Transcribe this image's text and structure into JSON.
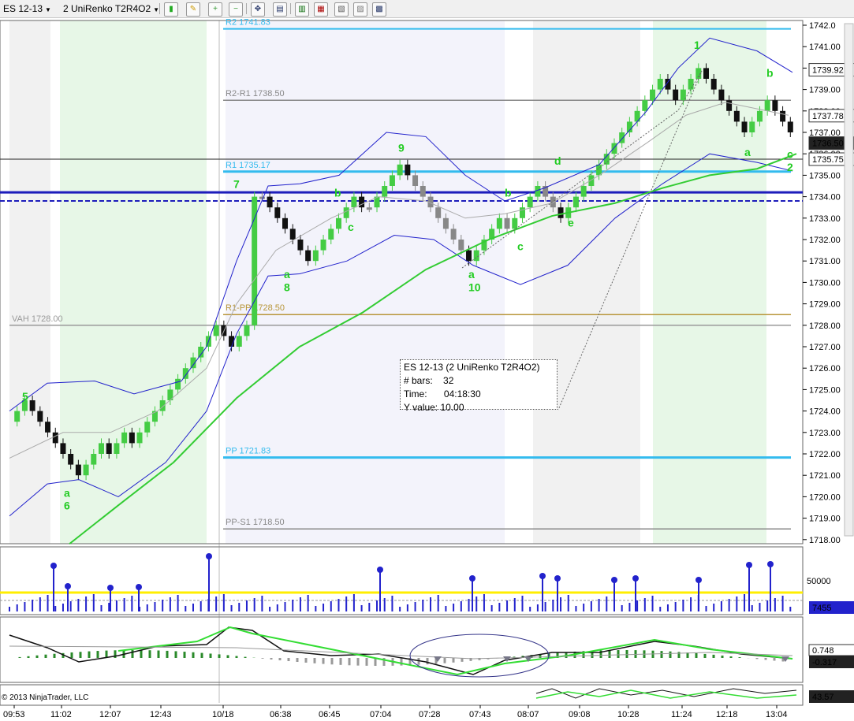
{
  "toolbar": {
    "instrument": "ES 12-13",
    "bar_type": "2 UniRenko T2R4O2"
  },
  "chart_data": {
    "type": "candlestick",
    "instrument": "ES 12-13",
    "bar_type": "2 UniRenko T2R4O2",
    "ylim": [
      1718,
      1742
    ],
    "y_ticks": [
      "1742.0",
      "1741.00",
      "1740.00",
      "1739.00",
      "1738.00",
      "1737.00",
      "1736.00",
      "1735.00",
      "1734.00",
      "1733.00",
      "1732.00",
      "1731.00",
      "1730.00",
      "1729.00",
      "1728.00",
      "1727.00",
      "1726.00",
      "1725.00",
      "1724.00",
      "1723.00",
      "1722.00",
      "1721.00",
      "1720.00",
      "1719.00",
      "1718.00"
    ],
    "x_ticks": [
      "09:53",
      "11:02",
      "12:07",
      "12:43",
      "10/18",
      "06:38",
      "06:45",
      "07:04",
      "07:28",
      "07:43",
      "08:07",
      "09:08",
      "10:28",
      "11:24",
      "12:18",
      "13:04"
    ],
    "price_flags": [
      "1739.92",
      "1737.78",
      "1736.50",
      "1735.75"
    ],
    "levels": [
      {
        "label": "R2 1741.83",
        "value": 1741.83,
        "color": "#33bbee"
      },
      {
        "label": "R2-R1 1738.50",
        "value": 1738.5,
        "color": "#888888"
      },
      {
        "label": "R1 1735.17",
        "value": 1735.17,
        "color": "#33bbee"
      },
      {
        "label": "R1-PP 1728.50",
        "value": 1728.5,
        "color": "#b8963a"
      },
      {
        "label": "VAH 1728.00",
        "value": 1728.0,
        "color": "#999999"
      },
      {
        "label": "PP 1721.83",
        "value": 1721.83,
        "color": "#33bbee"
      },
      {
        "label": "PP-S1 1718.50",
        "value": 1718.5,
        "color": "#888888"
      }
    ],
    "wave_labels": [
      "5",
      "a",
      "6",
      "7",
      "b",
      "c",
      "a",
      "8",
      "9",
      "b",
      "c",
      "a",
      "10",
      "d",
      "e",
      "1",
      "b",
      "a",
      "c",
      "2"
    ],
    "volume": {
      "y_tick": "50000",
      "last_value": "7455"
    },
    "oscillator": {
      "values": [
        "0.748",
        "-0.317"
      ]
    },
    "bottom_indicator": {
      "value": "43.57"
    },
    "tooltip": {
      "title": "ES 12-13 (2 UniRenko T2R4O2)",
      "bars_label": "# bars:",
      "bars_value": "32",
      "time_label": "Time:",
      "time_value": "04:18:30",
      "y_label": "Y value:",
      "y_value": "10.00"
    },
    "copyright": "© 2013 NinjaTrader, LLC",
    "colors": {
      "up": "#44cc44",
      "down": "#111111",
      "neutral": "#888888",
      "band": "#2222cc",
      "ma": "#33cc33",
      "level_cyan": "#33bbee",
      "volume": "#2222cc",
      "threshold": "#ffee00"
    }
  }
}
